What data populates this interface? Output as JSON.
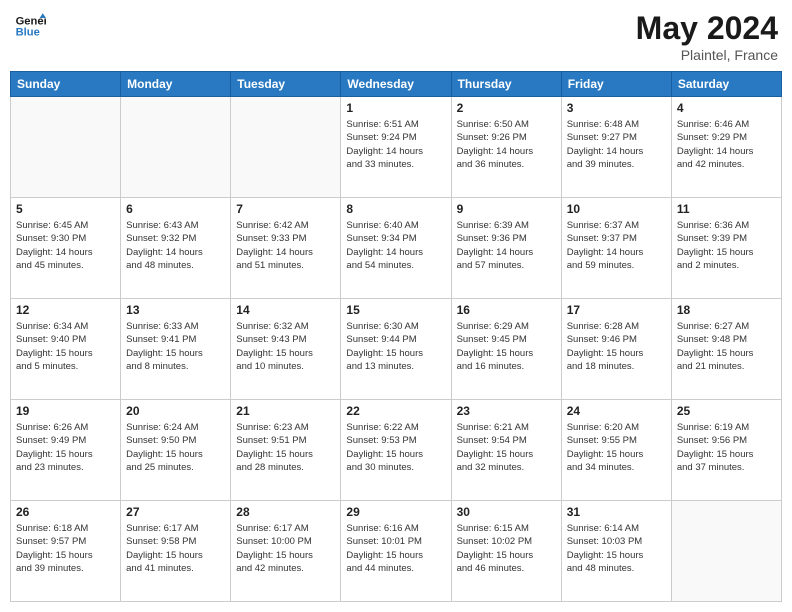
{
  "header": {
    "logo_line1": "General",
    "logo_line2": "Blue",
    "month_title": "May 2024",
    "location": "Plaintel, France"
  },
  "weekdays": [
    "Sunday",
    "Monday",
    "Tuesday",
    "Wednesday",
    "Thursday",
    "Friday",
    "Saturday"
  ],
  "weeks": [
    [
      {
        "day": "",
        "info": ""
      },
      {
        "day": "",
        "info": ""
      },
      {
        "day": "",
        "info": ""
      },
      {
        "day": "1",
        "info": "Sunrise: 6:51 AM\nSunset: 9:24 PM\nDaylight: 14 hours\nand 33 minutes."
      },
      {
        "day": "2",
        "info": "Sunrise: 6:50 AM\nSunset: 9:26 PM\nDaylight: 14 hours\nand 36 minutes."
      },
      {
        "day": "3",
        "info": "Sunrise: 6:48 AM\nSunset: 9:27 PM\nDaylight: 14 hours\nand 39 minutes."
      },
      {
        "day": "4",
        "info": "Sunrise: 6:46 AM\nSunset: 9:29 PM\nDaylight: 14 hours\nand 42 minutes."
      }
    ],
    [
      {
        "day": "5",
        "info": "Sunrise: 6:45 AM\nSunset: 9:30 PM\nDaylight: 14 hours\nand 45 minutes."
      },
      {
        "day": "6",
        "info": "Sunrise: 6:43 AM\nSunset: 9:32 PM\nDaylight: 14 hours\nand 48 minutes."
      },
      {
        "day": "7",
        "info": "Sunrise: 6:42 AM\nSunset: 9:33 PM\nDaylight: 14 hours\nand 51 minutes."
      },
      {
        "day": "8",
        "info": "Sunrise: 6:40 AM\nSunset: 9:34 PM\nDaylight: 14 hours\nand 54 minutes."
      },
      {
        "day": "9",
        "info": "Sunrise: 6:39 AM\nSunset: 9:36 PM\nDaylight: 14 hours\nand 57 minutes."
      },
      {
        "day": "10",
        "info": "Sunrise: 6:37 AM\nSunset: 9:37 PM\nDaylight: 14 hours\nand 59 minutes."
      },
      {
        "day": "11",
        "info": "Sunrise: 6:36 AM\nSunset: 9:39 PM\nDaylight: 15 hours\nand 2 minutes."
      }
    ],
    [
      {
        "day": "12",
        "info": "Sunrise: 6:34 AM\nSunset: 9:40 PM\nDaylight: 15 hours\nand 5 minutes."
      },
      {
        "day": "13",
        "info": "Sunrise: 6:33 AM\nSunset: 9:41 PM\nDaylight: 15 hours\nand 8 minutes."
      },
      {
        "day": "14",
        "info": "Sunrise: 6:32 AM\nSunset: 9:43 PM\nDaylight: 15 hours\nand 10 minutes."
      },
      {
        "day": "15",
        "info": "Sunrise: 6:30 AM\nSunset: 9:44 PM\nDaylight: 15 hours\nand 13 minutes."
      },
      {
        "day": "16",
        "info": "Sunrise: 6:29 AM\nSunset: 9:45 PM\nDaylight: 15 hours\nand 16 minutes."
      },
      {
        "day": "17",
        "info": "Sunrise: 6:28 AM\nSunset: 9:46 PM\nDaylight: 15 hours\nand 18 minutes."
      },
      {
        "day": "18",
        "info": "Sunrise: 6:27 AM\nSunset: 9:48 PM\nDaylight: 15 hours\nand 21 minutes."
      }
    ],
    [
      {
        "day": "19",
        "info": "Sunrise: 6:26 AM\nSunset: 9:49 PM\nDaylight: 15 hours\nand 23 minutes."
      },
      {
        "day": "20",
        "info": "Sunrise: 6:24 AM\nSunset: 9:50 PM\nDaylight: 15 hours\nand 25 minutes."
      },
      {
        "day": "21",
        "info": "Sunrise: 6:23 AM\nSunset: 9:51 PM\nDaylight: 15 hours\nand 28 minutes."
      },
      {
        "day": "22",
        "info": "Sunrise: 6:22 AM\nSunset: 9:53 PM\nDaylight: 15 hours\nand 30 minutes."
      },
      {
        "day": "23",
        "info": "Sunrise: 6:21 AM\nSunset: 9:54 PM\nDaylight: 15 hours\nand 32 minutes."
      },
      {
        "day": "24",
        "info": "Sunrise: 6:20 AM\nSunset: 9:55 PM\nDaylight: 15 hours\nand 34 minutes."
      },
      {
        "day": "25",
        "info": "Sunrise: 6:19 AM\nSunset: 9:56 PM\nDaylight: 15 hours\nand 37 minutes."
      }
    ],
    [
      {
        "day": "26",
        "info": "Sunrise: 6:18 AM\nSunset: 9:57 PM\nDaylight: 15 hours\nand 39 minutes."
      },
      {
        "day": "27",
        "info": "Sunrise: 6:17 AM\nSunset: 9:58 PM\nDaylight: 15 hours\nand 41 minutes."
      },
      {
        "day": "28",
        "info": "Sunrise: 6:17 AM\nSunset: 10:00 PM\nDaylight: 15 hours\nand 42 minutes."
      },
      {
        "day": "29",
        "info": "Sunrise: 6:16 AM\nSunset: 10:01 PM\nDaylight: 15 hours\nand 44 minutes."
      },
      {
        "day": "30",
        "info": "Sunrise: 6:15 AM\nSunset: 10:02 PM\nDaylight: 15 hours\nand 46 minutes."
      },
      {
        "day": "31",
        "info": "Sunrise: 6:14 AM\nSunset: 10:03 PM\nDaylight: 15 hours\nand 48 minutes."
      },
      {
        "day": "",
        "info": ""
      }
    ]
  ]
}
